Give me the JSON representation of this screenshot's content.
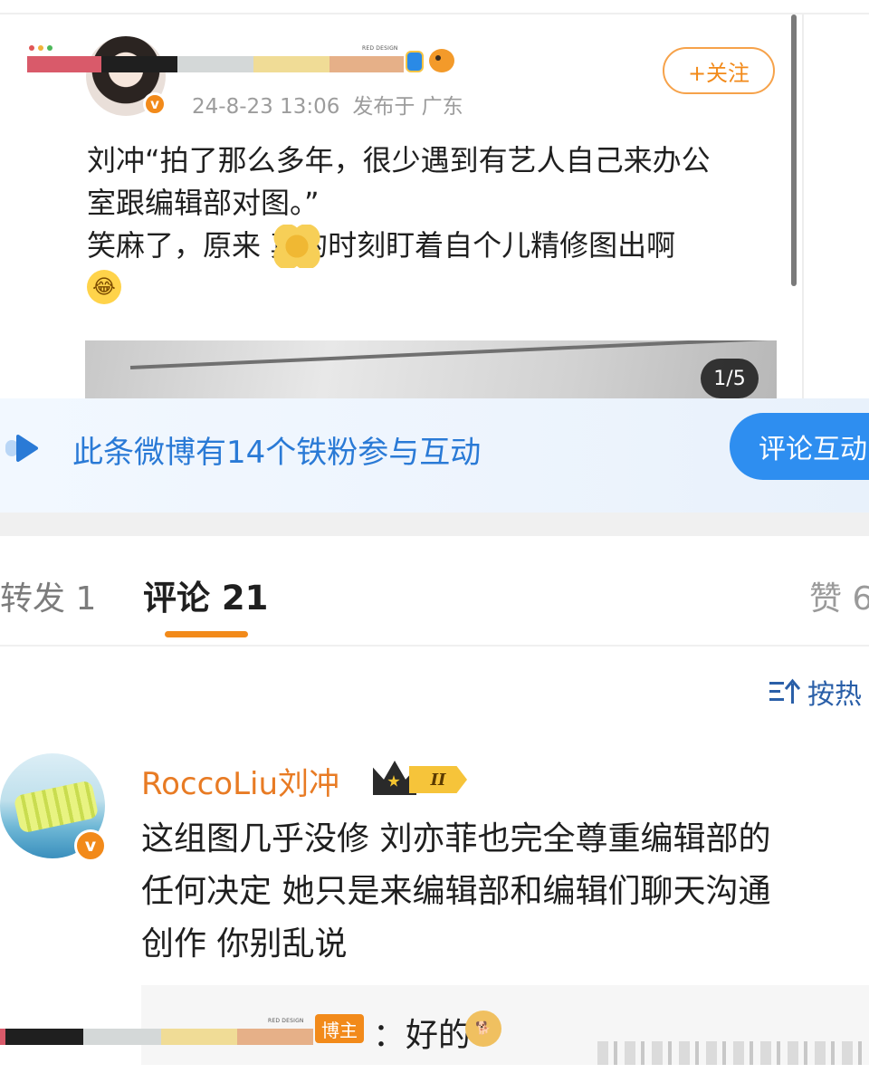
{
  "post": {
    "timestamp": "24-8-23 13:06",
    "location": "发布于 广东",
    "follow_label": "+关注",
    "text_lines": [
      "刘冲“拍了那么多年，很少遇到有艺人自己来办公",
      "室跟编辑部对图。”",
      "笑麻了，原来    真的时刻盯着自个儿精修图出啊"
    ],
    "image_counter": "1/5",
    "watermark": "RED DESIGN"
  },
  "fan_bar": {
    "text": "此条微博有14个铁粉参与互动",
    "button_label": "评论互动"
  },
  "tabs": {
    "repost": "转发 1",
    "comment": "评论 21",
    "like": "赞 6"
  },
  "sort": {
    "label": "按热"
  },
  "comment": {
    "author": "RoccoLiu刘冲",
    "level": "II",
    "lines": [
      "这组图几乎没修 刘亦菲也完全尊重编辑部的",
      "任何决定 她只是来编辑部和编辑们聊天沟通",
      "创作 你别乱说"
    ],
    "reply": {
      "tag": "博主",
      "text": "：好的"
    }
  },
  "colors": {
    "accent_orange": "#f28a1a",
    "link_blue": "#2a7ad6",
    "button_blue": "#2e8ef0"
  },
  "icons": [
    "v-verified-icon",
    "laugh-emoji-icon",
    "flower-sticker-icon",
    "fan-icon",
    "crown-icon",
    "sort-icon",
    "doge-emoji-icon"
  ]
}
